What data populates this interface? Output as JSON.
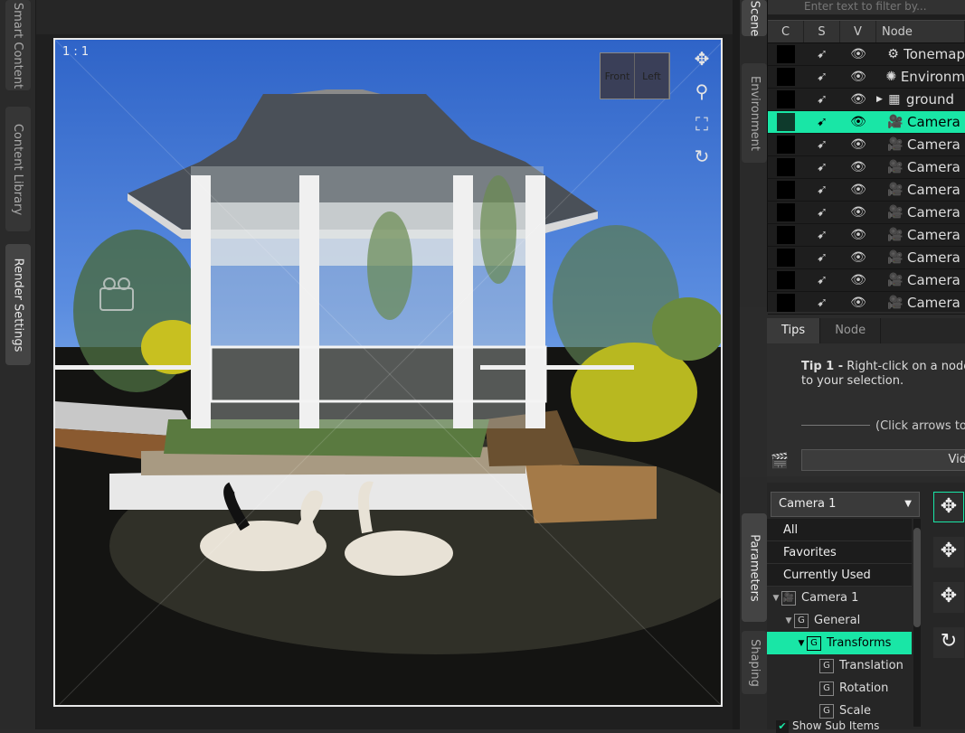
{
  "left_tabs": [
    {
      "label": "Smart Content",
      "active": false
    },
    {
      "label": "Content Library",
      "active": false
    },
    {
      "label": "Render Settings",
      "active": true
    }
  ],
  "viewport": {
    "ratio_label": "1 : 1",
    "cube_faces": [
      "Front",
      "Left"
    ],
    "tools": [
      "move-icon",
      "zoom-icon",
      "frame-icon",
      "orbit-icon"
    ]
  },
  "scene": {
    "side_tabs": [
      "Scene",
      "Environment"
    ],
    "filter_placeholder": "Enter text to filter by...",
    "columns": {
      "c": "C",
      "s": "S",
      "v": "V",
      "node": "Node"
    },
    "rows": [
      {
        "name": "Tonemap",
        "icon": "tonemap-icon",
        "selected": false,
        "expander": false
      },
      {
        "name": "Environm",
        "icon": "environment-icon",
        "selected": false,
        "expander": false
      },
      {
        "name": "ground",
        "icon": "prop-icon",
        "selected": false,
        "expander": true
      },
      {
        "name": "Camera",
        "icon": "camera-icon",
        "selected": true,
        "expander": false
      },
      {
        "name": "Camera",
        "icon": "camera-icon",
        "selected": false,
        "expander": false
      },
      {
        "name": "Camera",
        "icon": "camera-icon",
        "selected": false,
        "expander": false
      },
      {
        "name": "Camera",
        "icon": "camera-icon",
        "selected": false,
        "expander": false
      },
      {
        "name": "Camera",
        "icon": "camera-icon",
        "selected": false,
        "expander": false
      },
      {
        "name": "Camera",
        "icon": "camera-icon",
        "selected": false,
        "expander": false
      },
      {
        "name": "Camera",
        "icon": "camera-icon",
        "selected": false,
        "expander": false
      },
      {
        "name": "Camera",
        "icon": "camera-icon",
        "selected": false,
        "expander": false
      },
      {
        "name": "Camera",
        "icon": "camera-icon",
        "selected": false,
        "expander": false
      }
    ]
  },
  "tips": {
    "tabs": [
      "Tips",
      "Node"
    ],
    "tip_title": "Tip 1 -",
    "tip_body": " Right-click on a node to your selection.",
    "hint": "(Click arrows to",
    "button": "Vid"
  },
  "params": {
    "side_tabs": [
      "Parameters",
      "Shaping"
    ],
    "camera_select": "Camera 1",
    "categories": [
      "All",
      "Favorites",
      "Currently Used"
    ],
    "tree": [
      {
        "label": "Camera 1",
        "indent": 0,
        "twist": "▼",
        "icon": "camera-icon",
        "selected": false
      },
      {
        "label": "General",
        "indent": 1,
        "twist": "▼",
        "icon": "group-icon",
        "selected": false
      },
      {
        "label": "Transforms",
        "indent": 2,
        "twist": "▼",
        "icon": "group-icon",
        "selected": true
      },
      {
        "label": "Translation",
        "indent": 3,
        "twist": "",
        "icon": "group-icon",
        "selected": false
      },
      {
        "label": "Rotation",
        "indent": 3,
        "twist": "",
        "icon": "group-icon",
        "selected": false
      },
      {
        "label": "Scale",
        "indent": 3,
        "twist": "",
        "icon": "group-icon",
        "selected": false
      }
    ],
    "show_sub_items": "Show Sub Items"
  },
  "colors": {
    "accent": "#19e6a6"
  }
}
